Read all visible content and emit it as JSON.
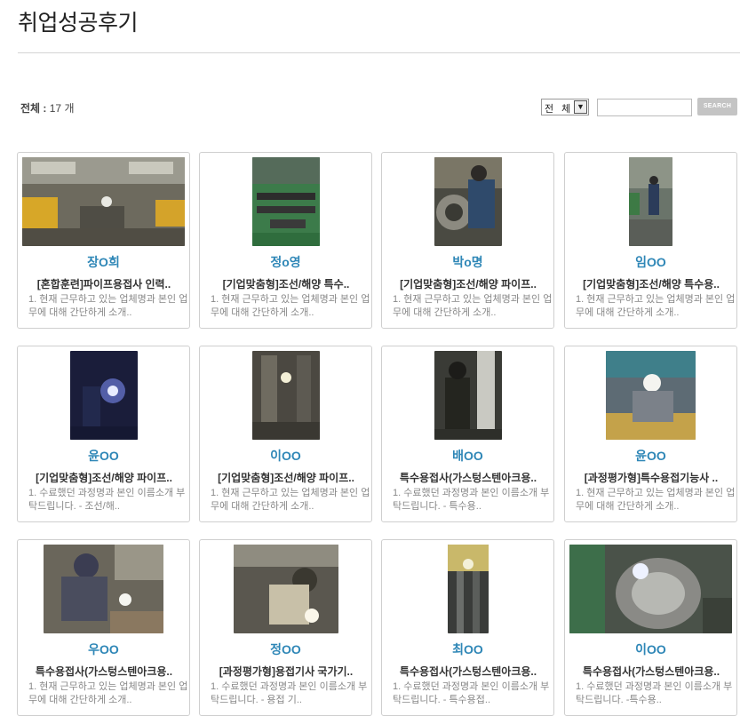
{
  "page": {
    "title": "취업성공후기"
  },
  "listing": {
    "total_label": "전체 : ",
    "total_count": "17",
    "total_unit": " 개"
  },
  "search": {
    "filter_selected": "전 체",
    "filter_arrow_icon": "chevron-down-icon",
    "query_value": "",
    "button_label": "SEARCH"
  },
  "colors": {
    "author": "#2f87b7",
    "border": "#cfcfcf",
    "search_button": "#c4c4c4"
  },
  "cards": [
    {
      "author": "장O희",
      "course": "[혼합훈련]파이프용접사 인력..",
      "excerpt": "1. 현재 근무하고 있는 업체명과 본인 업무에 대해 간단하게 소개..",
      "photo": "workshop-photo"
    },
    {
      "author": "정o영",
      "course": "[기업맞춤형]조선/해양 특수..",
      "excerpt": "1. 현재 근무하고 있는 업체명과 본인 업무에 대해 간단하게 소개..",
      "photo": "pipe-workshop-photo"
    },
    {
      "author": "박o명",
      "course": "[기업맞춤형]조선/해양 파이프..",
      "excerpt": "1. 현재 근무하고 있는 업체명과 본인 업무에 대해 간단하게 소개..",
      "photo": "pipe-welder-photo"
    },
    {
      "author": "임OO",
      "course": "[기업맞춤형]조선/해양 특수용..",
      "excerpt": "1. 현재 근무하고 있는 업체명과 본인 업무에 대해 간단하게 소개..",
      "photo": "factory-worker-photo"
    },
    {
      "author": "윤OO",
      "course": "[기업맞춤형]조선/해양 파이프..",
      "excerpt": "1. 수료했던 과정명과 본인 이름소개 부탁드립니다. - 조선/해..",
      "photo": "welding-spark-photo"
    },
    {
      "author": "이OO",
      "course": "[기업맞춤형]조선/해양 파이프..",
      "excerpt": "1. 현재 근무하고 있는 업체명과 본인 업무에 대해 간단하게 소개..",
      "photo": "pipe-welding-photo"
    },
    {
      "author": "배OO",
      "course": "특수용접사(가스텅스텐아크용..",
      "excerpt": "1. 수료했던 과정명과 본인 이름소개 부탁드립니다. - 특수용..",
      "photo": "welder-mask-photo"
    },
    {
      "author": "윤OO",
      "course": "[과정평가형]특수용접기능사 ..",
      "excerpt": "1. 현재 근무하고 있는 업체명과 본인 업무에 대해 간단하게 소개..",
      "photo": "helmet-worker-photo"
    },
    {
      "author": "우OO",
      "course": "특수용접사(가스텅스텐아크용..",
      "excerpt": "1. 현재 근무하고 있는 업체명과 본인 업무에 대해 간단하게 소개..",
      "photo": "tig-welder-photo"
    },
    {
      "author": "정OO",
      "course": "[과정평가형]용접기사 국가기..",
      "excerpt": "1. 수료했던 과정명과 본인 이름소개 부탁드립니다. - 용접 기..",
      "photo": "welding-helmet-photo"
    },
    {
      "author": "최OO",
      "course": "특수용접사(가스텅스텐아크용..",
      "excerpt": "1. 수료했던 과정명과 본인 이름소개 부탁드립니다. - 특수용접..",
      "photo": "vertical-weld-photo"
    },
    {
      "author": "이OO",
      "course": "특수용접사(가스텅스텐아크용..",
      "excerpt": "1. 수료했던 과정명과 본인 이름소개 부탁드립니다. -특수용..",
      "photo": "large-pipe-weld-photo"
    }
  ]
}
